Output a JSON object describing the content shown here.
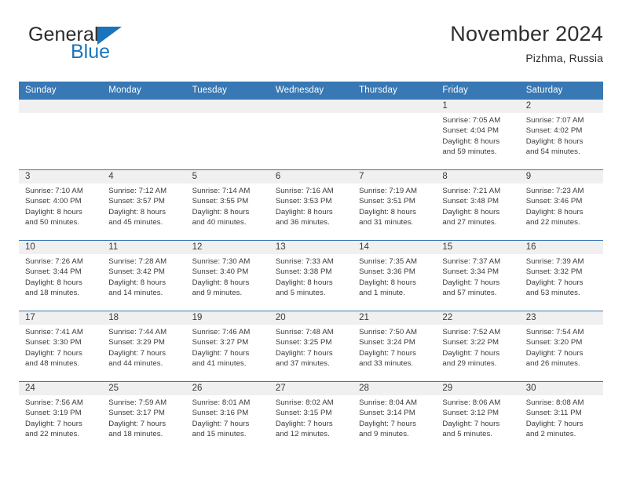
{
  "brand": {
    "name_part1": "General",
    "name_part2": "Blue",
    "triangle_color": "#1a74bb"
  },
  "header": {
    "title": "November 2024",
    "subtitle": "Pizhma, Russia",
    "header_bg": "#3878b4",
    "header_text_color": "#ffffff",
    "daynum_bg": "#f0f0f0"
  },
  "weekday_headers": [
    "Sunday",
    "Monday",
    "Tuesday",
    "Wednesday",
    "Thursday",
    "Friday",
    "Saturday"
  ],
  "labels": {
    "sunrise": "Sunrise:",
    "sunset": "Sunset:",
    "daylight": "Daylight:"
  },
  "weeks": [
    [
      {
        "day": "",
        "lines": []
      },
      {
        "day": "",
        "lines": []
      },
      {
        "day": "",
        "lines": []
      },
      {
        "day": "",
        "lines": []
      },
      {
        "day": "",
        "lines": []
      },
      {
        "day": "1",
        "lines": [
          "Sunrise: 7:05 AM",
          "Sunset: 4:04 PM",
          "Daylight: 8 hours",
          "and 59 minutes."
        ]
      },
      {
        "day": "2",
        "lines": [
          "Sunrise: 7:07 AM",
          "Sunset: 4:02 PM",
          "Daylight: 8 hours",
          "and 54 minutes."
        ]
      }
    ],
    [
      {
        "day": "3",
        "lines": [
          "Sunrise: 7:10 AM",
          "Sunset: 4:00 PM",
          "Daylight: 8 hours",
          "and 50 minutes."
        ]
      },
      {
        "day": "4",
        "lines": [
          "Sunrise: 7:12 AM",
          "Sunset: 3:57 PM",
          "Daylight: 8 hours",
          "and 45 minutes."
        ]
      },
      {
        "day": "5",
        "lines": [
          "Sunrise: 7:14 AM",
          "Sunset: 3:55 PM",
          "Daylight: 8 hours",
          "and 40 minutes."
        ]
      },
      {
        "day": "6",
        "lines": [
          "Sunrise: 7:16 AM",
          "Sunset: 3:53 PM",
          "Daylight: 8 hours",
          "and 36 minutes."
        ]
      },
      {
        "day": "7",
        "lines": [
          "Sunrise: 7:19 AM",
          "Sunset: 3:51 PM",
          "Daylight: 8 hours",
          "and 31 minutes."
        ]
      },
      {
        "day": "8",
        "lines": [
          "Sunrise: 7:21 AM",
          "Sunset: 3:48 PM",
          "Daylight: 8 hours",
          "and 27 minutes."
        ]
      },
      {
        "day": "9",
        "lines": [
          "Sunrise: 7:23 AM",
          "Sunset: 3:46 PM",
          "Daylight: 8 hours",
          "and 22 minutes."
        ]
      }
    ],
    [
      {
        "day": "10",
        "lines": [
          "Sunrise: 7:26 AM",
          "Sunset: 3:44 PM",
          "Daylight: 8 hours",
          "and 18 minutes."
        ]
      },
      {
        "day": "11",
        "lines": [
          "Sunrise: 7:28 AM",
          "Sunset: 3:42 PM",
          "Daylight: 8 hours",
          "and 14 minutes."
        ]
      },
      {
        "day": "12",
        "lines": [
          "Sunrise: 7:30 AM",
          "Sunset: 3:40 PM",
          "Daylight: 8 hours",
          "and 9 minutes."
        ]
      },
      {
        "day": "13",
        "lines": [
          "Sunrise: 7:33 AM",
          "Sunset: 3:38 PM",
          "Daylight: 8 hours",
          "and 5 minutes."
        ]
      },
      {
        "day": "14",
        "lines": [
          "Sunrise: 7:35 AM",
          "Sunset: 3:36 PM",
          "Daylight: 8 hours",
          "and 1 minute."
        ]
      },
      {
        "day": "15",
        "lines": [
          "Sunrise: 7:37 AM",
          "Sunset: 3:34 PM",
          "Daylight: 7 hours",
          "and 57 minutes."
        ]
      },
      {
        "day": "16",
        "lines": [
          "Sunrise: 7:39 AM",
          "Sunset: 3:32 PM",
          "Daylight: 7 hours",
          "and 53 minutes."
        ]
      }
    ],
    [
      {
        "day": "17",
        "lines": [
          "Sunrise: 7:41 AM",
          "Sunset: 3:30 PM",
          "Daylight: 7 hours",
          "and 48 minutes."
        ]
      },
      {
        "day": "18",
        "lines": [
          "Sunrise: 7:44 AM",
          "Sunset: 3:29 PM",
          "Daylight: 7 hours",
          "and 44 minutes."
        ]
      },
      {
        "day": "19",
        "lines": [
          "Sunrise: 7:46 AM",
          "Sunset: 3:27 PM",
          "Daylight: 7 hours",
          "and 41 minutes."
        ]
      },
      {
        "day": "20",
        "lines": [
          "Sunrise: 7:48 AM",
          "Sunset: 3:25 PM",
          "Daylight: 7 hours",
          "and 37 minutes."
        ]
      },
      {
        "day": "21",
        "lines": [
          "Sunrise: 7:50 AM",
          "Sunset: 3:24 PM",
          "Daylight: 7 hours",
          "and 33 minutes."
        ]
      },
      {
        "day": "22",
        "lines": [
          "Sunrise: 7:52 AM",
          "Sunset: 3:22 PM",
          "Daylight: 7 hours",
          "and 29 minutes."
        ]
      },
      {
        "day": "23",
        "lines": [
          "Sunrise: 7:54 AM",
          "Sunset: 3:20 PM",
          "Daylight: 7 hours",
          "and 26 minutes."
        ]
      }
    ],
    [
      {
        "day": "24",
        "lines": [
          "Sunrise: 7:56 AM",
          "Sunset: 3:19 PM",
          "Daylight: 7 hours",
          "and 22 minutes."
        ]
      },
      {
        "day": "25",
        "lines": [
          "Sunrise: 7:59 AM",
          "Sunset: 3:17 PM",
          "Daylight: 7 hours",
          "and 18 minutes."
        ]
      },
      {
        "day": "26",
        "lines": [
          "Sunrise: 8:01 AM",
          "Sunset: 3:16 PM",
          "Daylight: 7 hours",
          "and 15 minutes."
        ]
      },
      {
        "day": "27",
        "lines": [
          "Sunrise: 8:02 AM",
          "Sunset: 3:15 PM",
          "Daylight: 7 hours",
          "and 12 minutes."
        ]
      },
      {
        "day": "28",
        "lines": [
          "Sunrise: 8:04 AM",
          "Sunset: 3:14 PM",
          "Daylight: 7 hours",
          "and 9 minutes."
        ]
      },
      {
        "day": "29",
        "lines": [
          "Sunrise: 8:06 AM",
          "Sunset: 3:12 PM",
          "Daylight: 7 hours",
          "and 5 minutes."
        ]
      },
      {
        "day": "30",
        "lines": [
          "Sunrise: 8:08 AM",
          "Sunset: 3:11 PM",
          "Daylight: 7 hours",
          "and 2 minutes."
        ]
      }
    ]
  ]
}
